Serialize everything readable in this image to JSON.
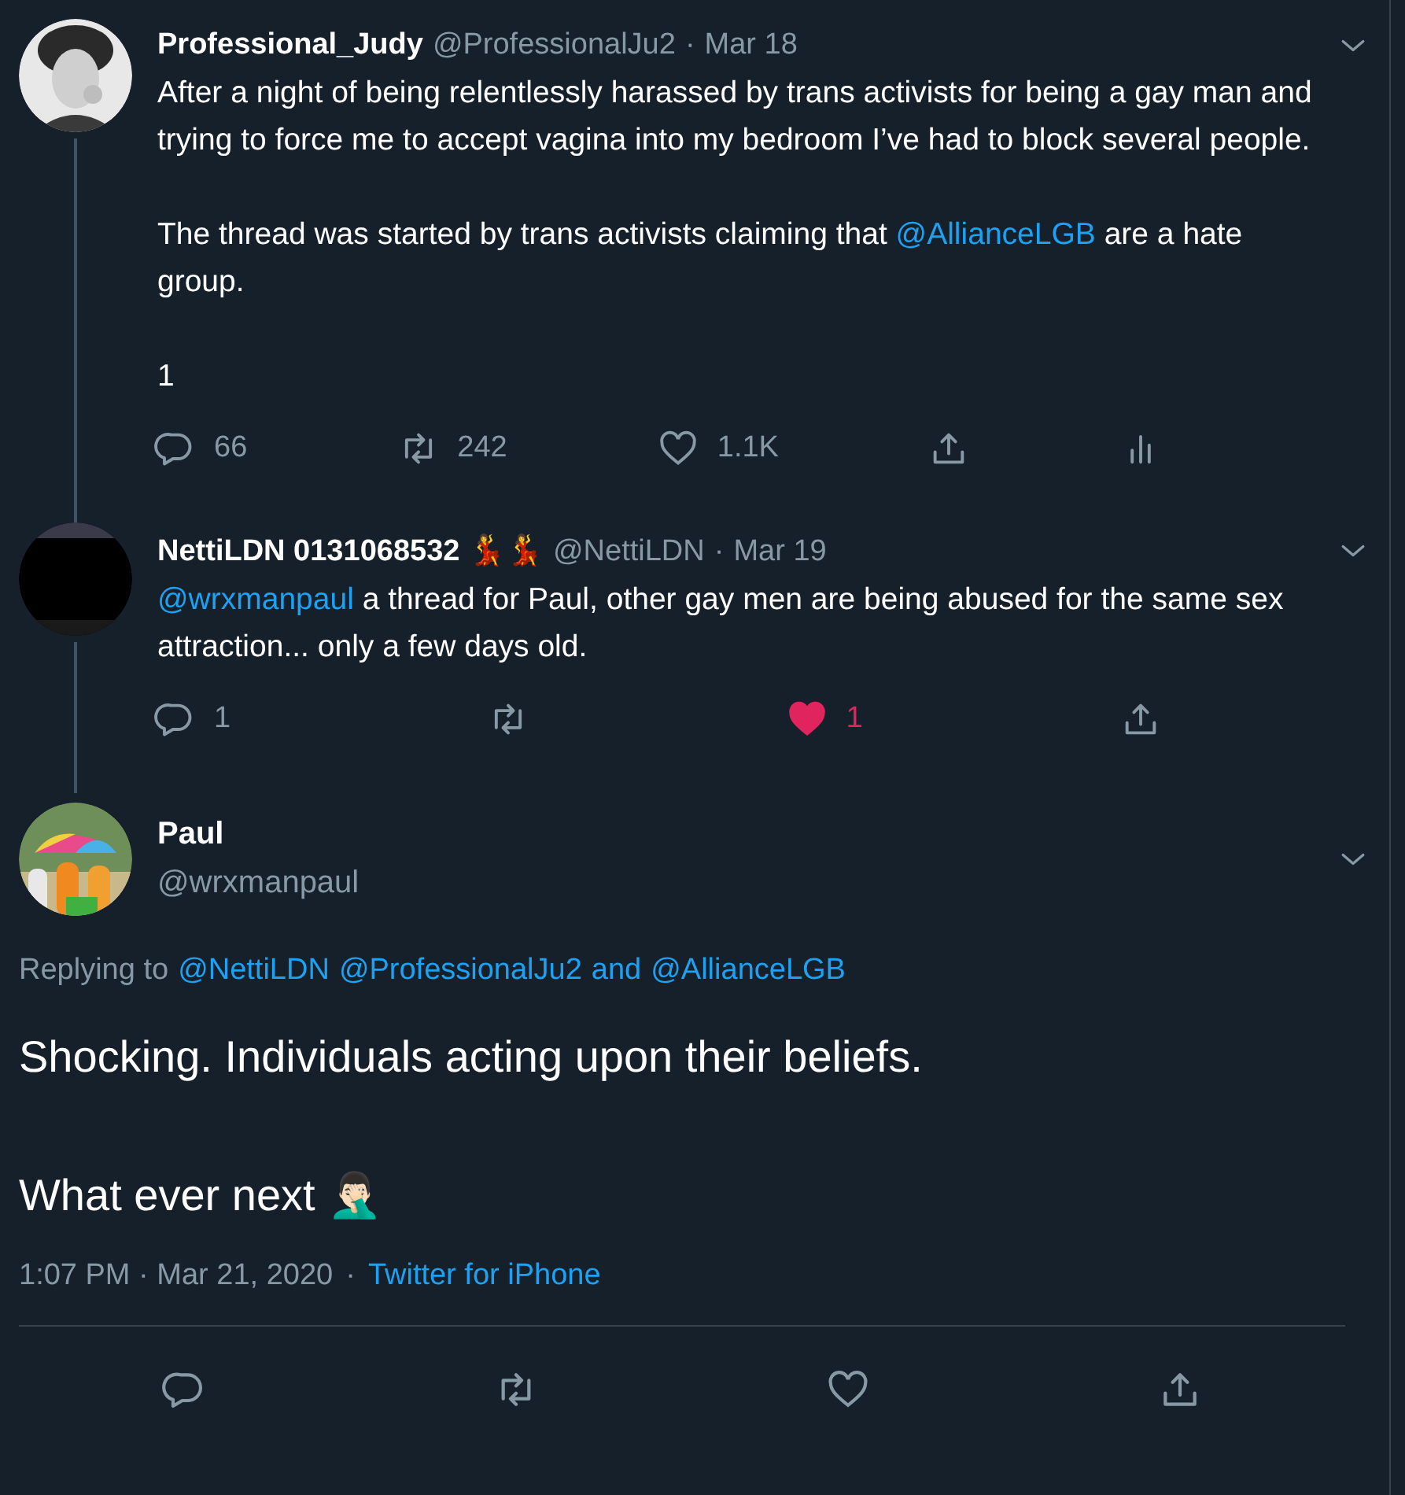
{
  "thread": [
    {
      "avatar": {
        "kind": "picture"
      },
      "name": "Professional_Judy",
      "handle": "@ProfessionalJu2",
      "separator": "·",
      "date": "Mar 18",
      "paragraphs": [
        [
          {
            "kind": "text",
            "text": "After a night of being relentlessly harassed by trans activists for being a gay man and trying to force me to accept vagina into my bedroom I’ve had to block several people."
          }
        ],
        [
          {
            "kind": "text",
            "text": "The thread was started by trans activists claiming that "
          },
          {
            "kind": "mention",
            "text": "@AllianceLGB"
          },
          {
            "kind": "text",
            "text": " are a hate group."
          }
        ],
        [
          {
            "kind": "text",
            "text": "1"
          }
        ]
      ],
      "actions": [
        {
          "kind": "reply",
          "count": "66"
        },
        {
          "kind": "retweet",
          "count": "242"
        },
        {
          "kind": "like",
          "count": "1.1K",
          "liked": false
        },
        {
          "kind": "share"
        },
        {
          "kind": "analytics"
        }
      ]
    },
    {
      "avatar": {
        "kind": "picture"
      },
      "name": "NettiLDN 0131068532 💃💃",
      "handle": "@NettiLDN",
      "separator": "·",
      "date": "Mar 19",
      "paragraphs": [
        [
          {
            "kind": "mention",
            "text": "@wrxmanpaul"
          },
          {
            "kind": "text",
            "text": " a thread for Paul, other gay men are being abused for the same sex attraction... only a few days old."
          }
        ]
      ],
      "actions": [
        {
          "kind": "reply",
          "count": "1"
        },
        {
          "kind": "retweet"
        },
        {
          "kind": "like",
          "count": "1",
          "liked": true
        },
        {
          "kind": "share"
        }
      ]
    }
  ],
  "main_tweet": {
    "avatar": {
      "kind": "picture"
    },
    "name": "Paul",
    "handle": "@wrxmanpaul",
    "replying": {
      "label": "Replying to",
      "mentions": [
        "@NettiLDN",
        "@ProfessionalJu2"
      ],
      "conjunction": "and",
      "last": "@AllianceLGB"
    },
    "paragraphs": [
      [
        {
          "kind": "text",
          "text": "Shocking. Individuals acting upon their beliefs."
        }
      ],
      [
        {
          "kind": "text",
          "text": "What ever next 🤦🏻‍♂️"
        }
      ]
    ],
    "time": "1:07 PM · Mar 21, 2020",
    "separator": "·",
    "source": "Twitter for iPhone",
    "actions": [
      {
        "kind": "reply"
      },
      {
        "kind": "retweet"
      },
      {
        "kind": "like",
        "liked": false
      },
      {
        "kind": "share"
      }
    ]
  }
}
